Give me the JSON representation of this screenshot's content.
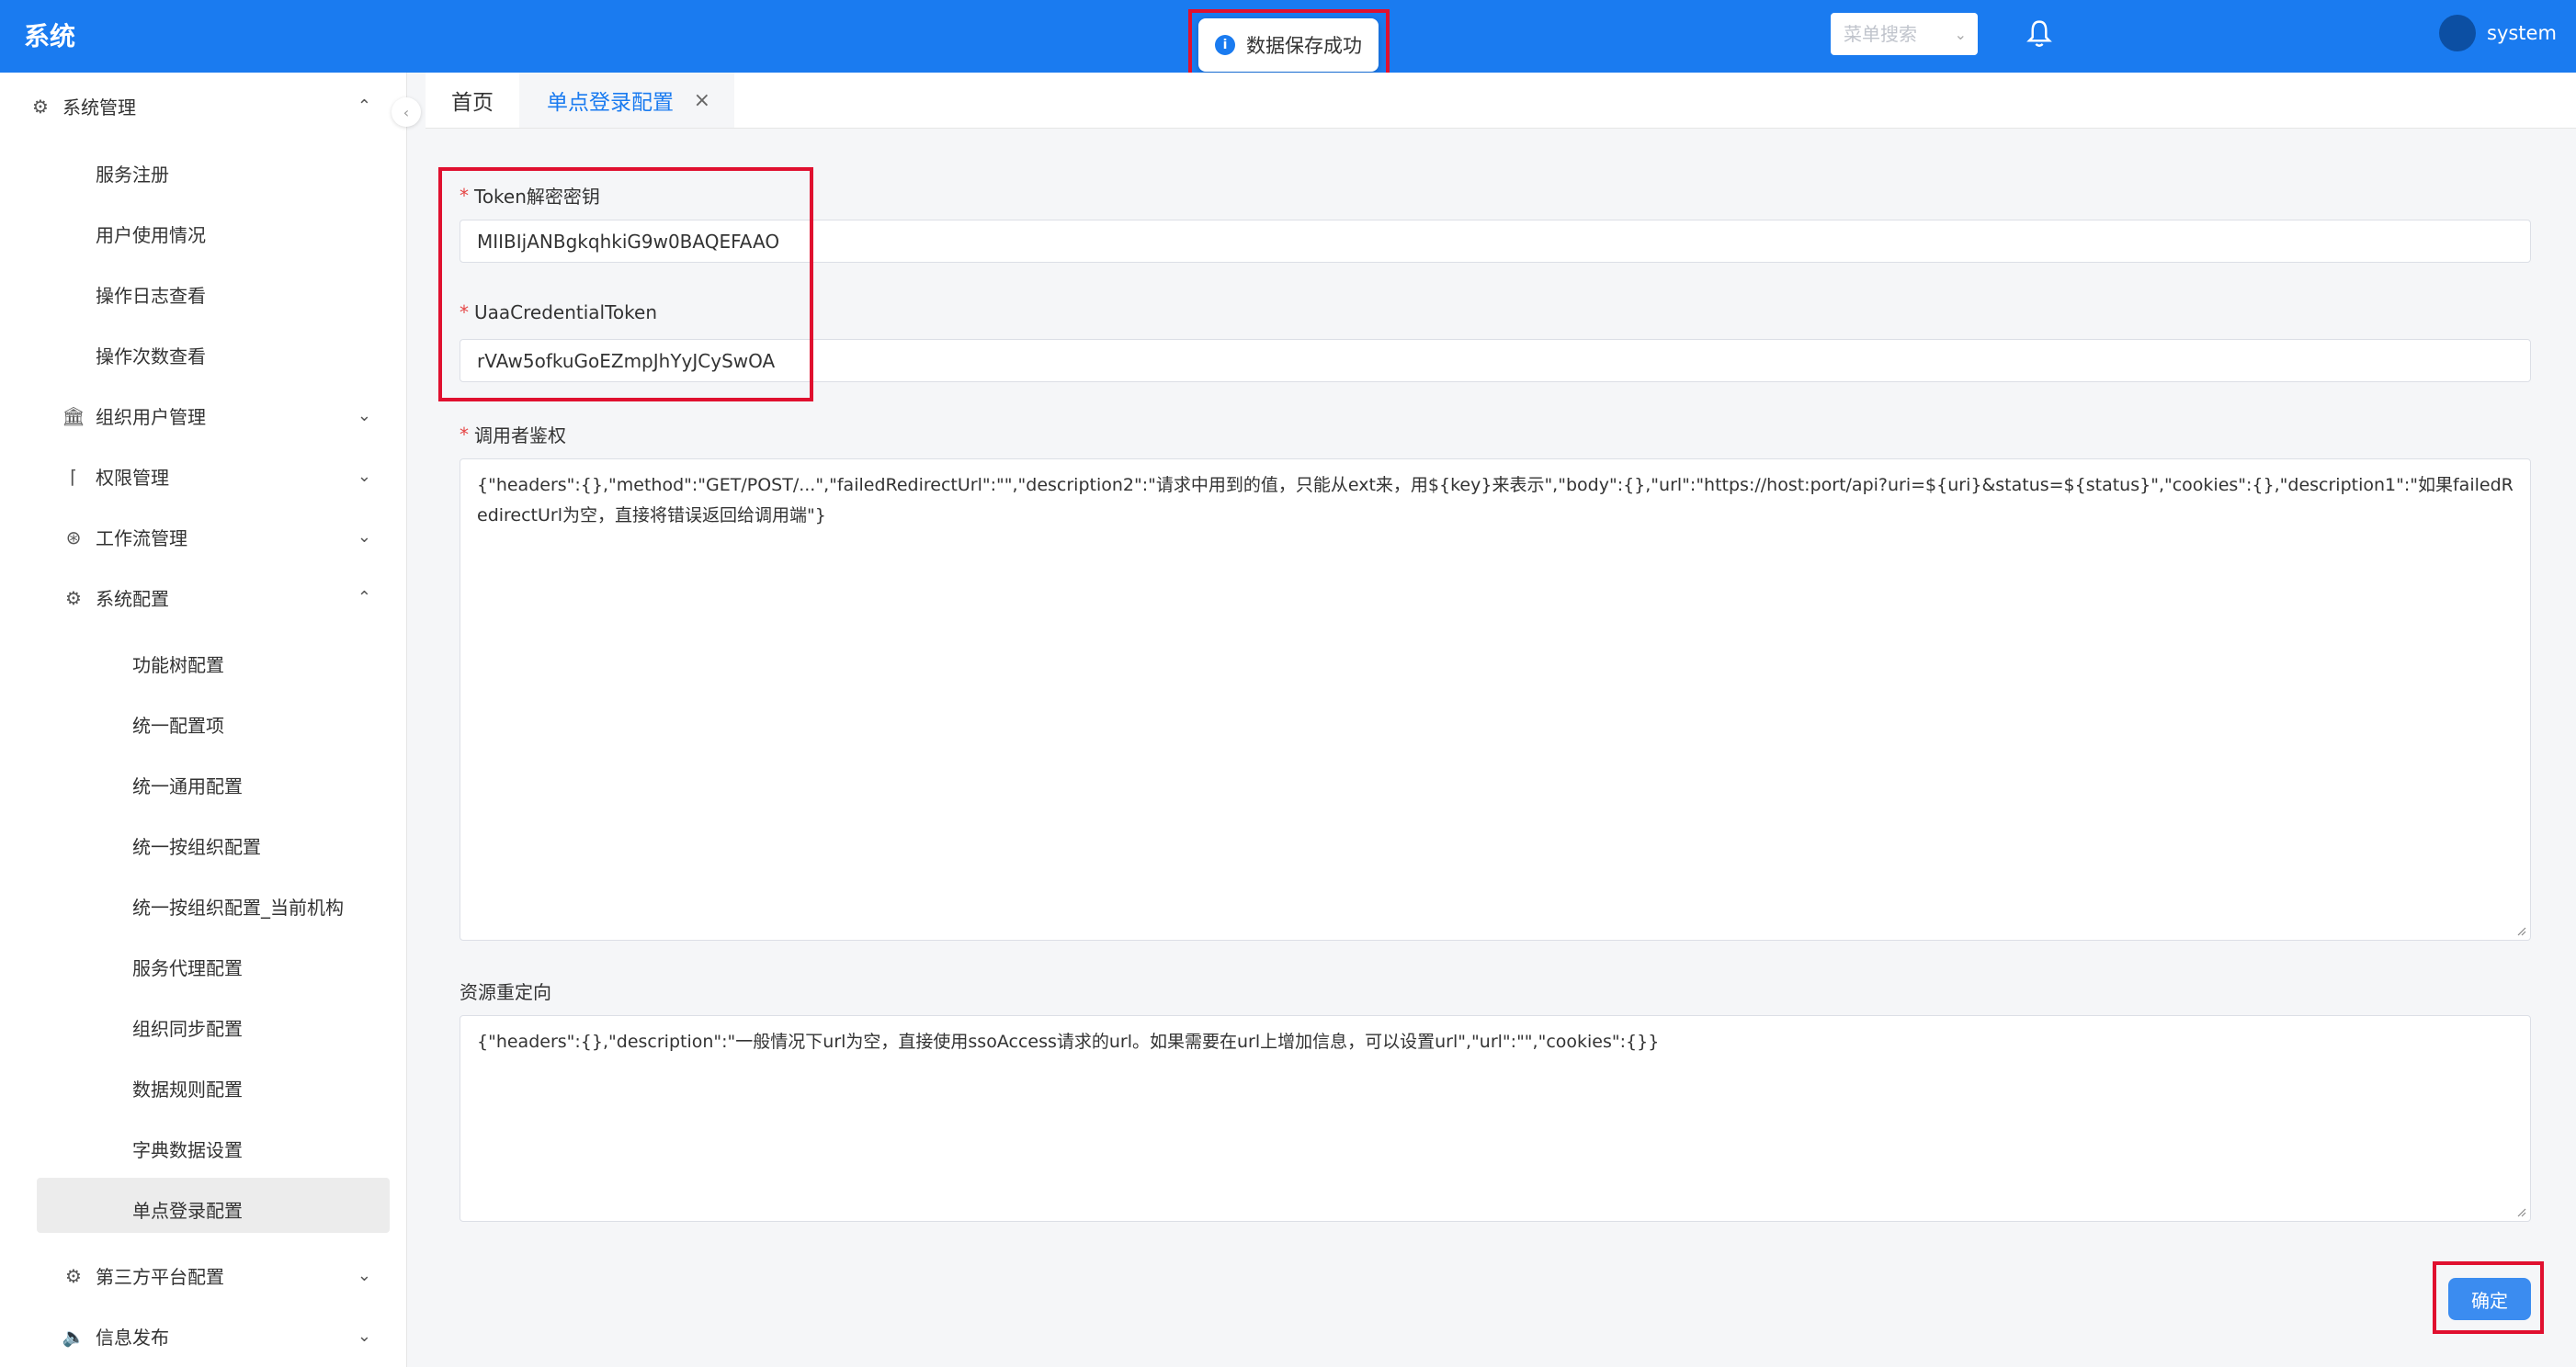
{
  "header": {
    "brand": "系统",
    "toast": "数据保存成功",
    "menu_search_placeholder": "菜单搜索",
    "username": "system"
  },
  "sidebar": {
    "sections": [
      {
        "label": "系统管理",
        "icon": "gear-icon",
        "expanded": true
      },
      {
        "label": "组织用户管理",
        "icon": "bank-icon",
        "expanded": false
      },
      {
        "label": "权限管理",
        "icon": "user-icon",
        "expanded": false
      },
      {
        "label": "工作流管理",
        "icon": "flow-icon",
        "expanded": false
      },
      {
        "label": "系统配置",
        "icon": "gear-icon",
        "expanded": true
      },
      {
        "label": "第三方平台配置",
        "icon": "gear-icon",
        "expanded": false
      },
      {
        "label": "信息发布",
        "icon": "speaker-icon",
        "expanded": false
      }
    ],
    "system_mgmt_items": [
      "服务注册",
      "用户使用情况",
      "操作日志查看",
      "操作次数查看"
    ],
    "system_config_items": [
      "功能树配置",
      "统一配置项",
      "统一通用配置",
      "统一按组织配置",
      "统一按组织配置_当前机构",
      "服务代理配置",
      "组织同步配置",
      "数据规则配置",
      "字典数据设置",
      "单点登录配置"
    ],
    "active_item": "单点登录配置"
  },
  "tabs": [
    {
      "label": "首页",
      "active": false
    },
    {
      "label": "单点登录配置",
      "active": true
    }
  ],
  "form": {
    "token_key_label": "Token解密密钥",
    "token_key_value": "MIIBIjANBgkqhkiG9w0BAQEFAAO",
    "uaa_label": "UaaCredentialToken",
    "uaa_value": "rVAw5ofkuGoEZmpJhYyJCySwOA",
    "caller_auth_label": "调用者鉴权",
    "caller_auth_value": "{\"headers\":{},\"method\":\"GET/POST/...\",\"failedRedirectUrl\":\"\",\"description2\":\"请求中用到的值，只能从ext来，用${key}来表示\",\"body\":{},\"url\":\"https://host:port/api?uri=${uri}&status=${status}\",\"cookies\":{},\"description1\":\"如果failedRedirectUrl为空，直接将错误返回给调用端\"}",
    "redirect_label": "资源重定向",
    "redirect_value": "{\"headers\":{},\"description\":\"一般情况下url为空，直接使用ssoAccess请求的url。如果需要在url上增加信息，可以设置url\",\"url\":\"\",\"cookies\":{}}",
    "confirm_label": "确定"
  },
  "colors": {
    "primary": "#1a7bf0",
    "highlight": "#e0102f",
    "required": "#e54545"
  }
}
